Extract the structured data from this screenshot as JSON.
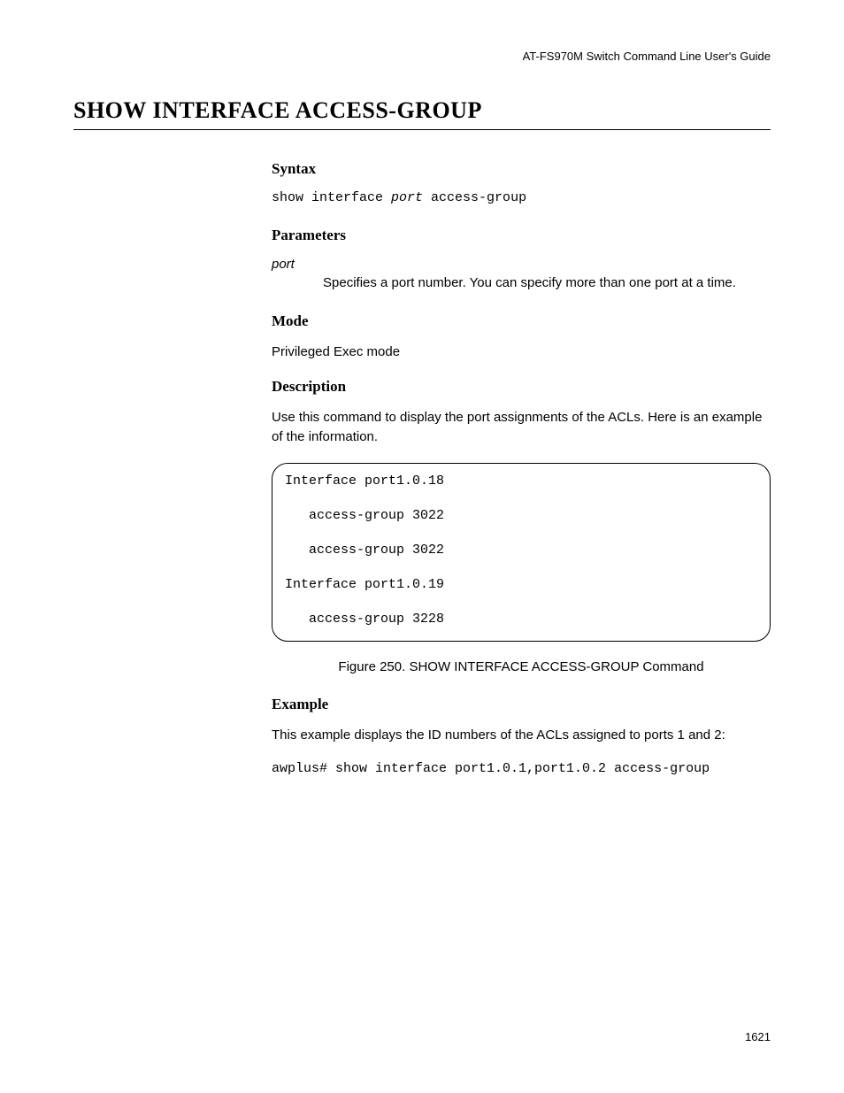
{
  "header": {
    "guide": "AT-FS970M Switch Command Line User's Guide"
  },
  "title": "SHOW INTERFACE ACCESS-GROUP",
  "syntax": {
    "heading": "Syntax",
    "prefix": "show interface ",
    "param": "port",
    "suffix": " access-group"
  },
  "parameters": {
    "heading": "Parameters",
    "items": [
      {
        "name": "port",
        "desc": "Specifies a port number. You can specify more than one port at a time."
      }
    ]
  },
  "mode": {
    "heading": "Mode",
    "text": "Privileged Exec mode"
  },
  "description": {
    "heading": "Description",
    "text": "Use this command to display the port assignments of the ACLs. Here is an example of the information."
  },
  "output_box": "Interface port1.0.18\n\n   access-group 3022\n\n   access-group 3022\n\nInterface port1.0.19\n\n   access-group 3228",
  "figure_caption": "Figure 250. SHOW INTERFACE ACCESS-GROUP Command",
  "example": {
    "heading": "Example",
    "text": "This example displays the ID numbers of the ACLs assigned to ports 1 and 2:",
    "command": "awplus# show interface port1.0.1,port1.0.2 access-group"
  },
  "page_number": "1621"
}
